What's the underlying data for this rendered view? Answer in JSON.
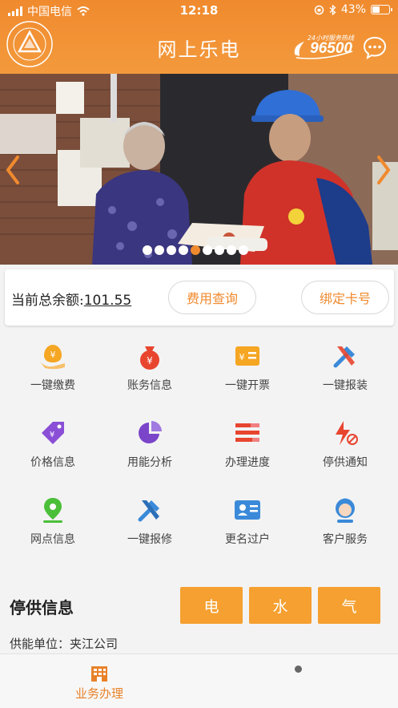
{
  "status_bar": {
    "carrier": "中国电信",
    "time": "12:18",
    "battery_percent": "43%",
    "battery_level": 0.43
  },
  "header": {
    "title": "网上乐电",
    "hotline_caption": "24小时服务热线",
    "hotline_number": "96500"
  },
  "banner": {
    "slide_count": 9,
    "active_index": 4
  },
  "balance": {
    "label": "当前总余额:",
    "value": "101.55",
    "query_button": "费用查询",
    "bind_button": "绑定卡号"
  },
  "services": [
    {
      "label": "一键缴费",
      "icon": "payment-bag-icon",
      "color": "#f5a623"
    },
    {
      "label": "账务信息",
      "icon": "money-bag-icon",
      "color": "#e8452f"
    },
    {
      "label": "一键开票",
      "icon": "invoice-icon",
      "color": "#f5a623"
    },
    {
      "label": "一键报装",
      "icon": "tools-icon",
      "color": "#3b8ad9"
    },
    {
      "label": "价格信息",
      "icon": "price-tag-icon",
      "color": "#8a4fd6"
    },
    {
      "label": "用能分析",
      "icon": "pie-chart-icon",
      "color": "#7a45c9"
    },
    {
      "label": "办理进度",
      "icon": "progress-list-icon",
      "color": "#e8452f"
    },
    {
      "label": "停供通知",
      "icon": "power-off-icon",
      "color": "#e8452f"
    },
    {
      "label": "网点信息",
      "icon": "location-pin-icon",
      "color": "#4cbf3a"
    },
    {
      "label": "一键报修",
      "icon": "repair-tools-icon",
      "color": "#3b8ad9"
    },
    {
      "label": "更名过户",
      "icon": "id-card-icon",
      "color": "#3b8ad9"
    },
    {
      "label": "客户服务",
      "icon": "customer-service-icon",
      "color": "#3b8ad9"
    }
  ],
  "outage": {
    "title": "停供信息",
    "types": [
      "电",
      "水",
      "气"
    ],
    "supplier_text": "供能单位：夹江公司"
  },
  "tabbar": {
    "business_label": "业务办理"
  },
  "colors": {
    "brand_orange": "#f08a2e",
    "button_orange": "#f5a030"
  }
}
